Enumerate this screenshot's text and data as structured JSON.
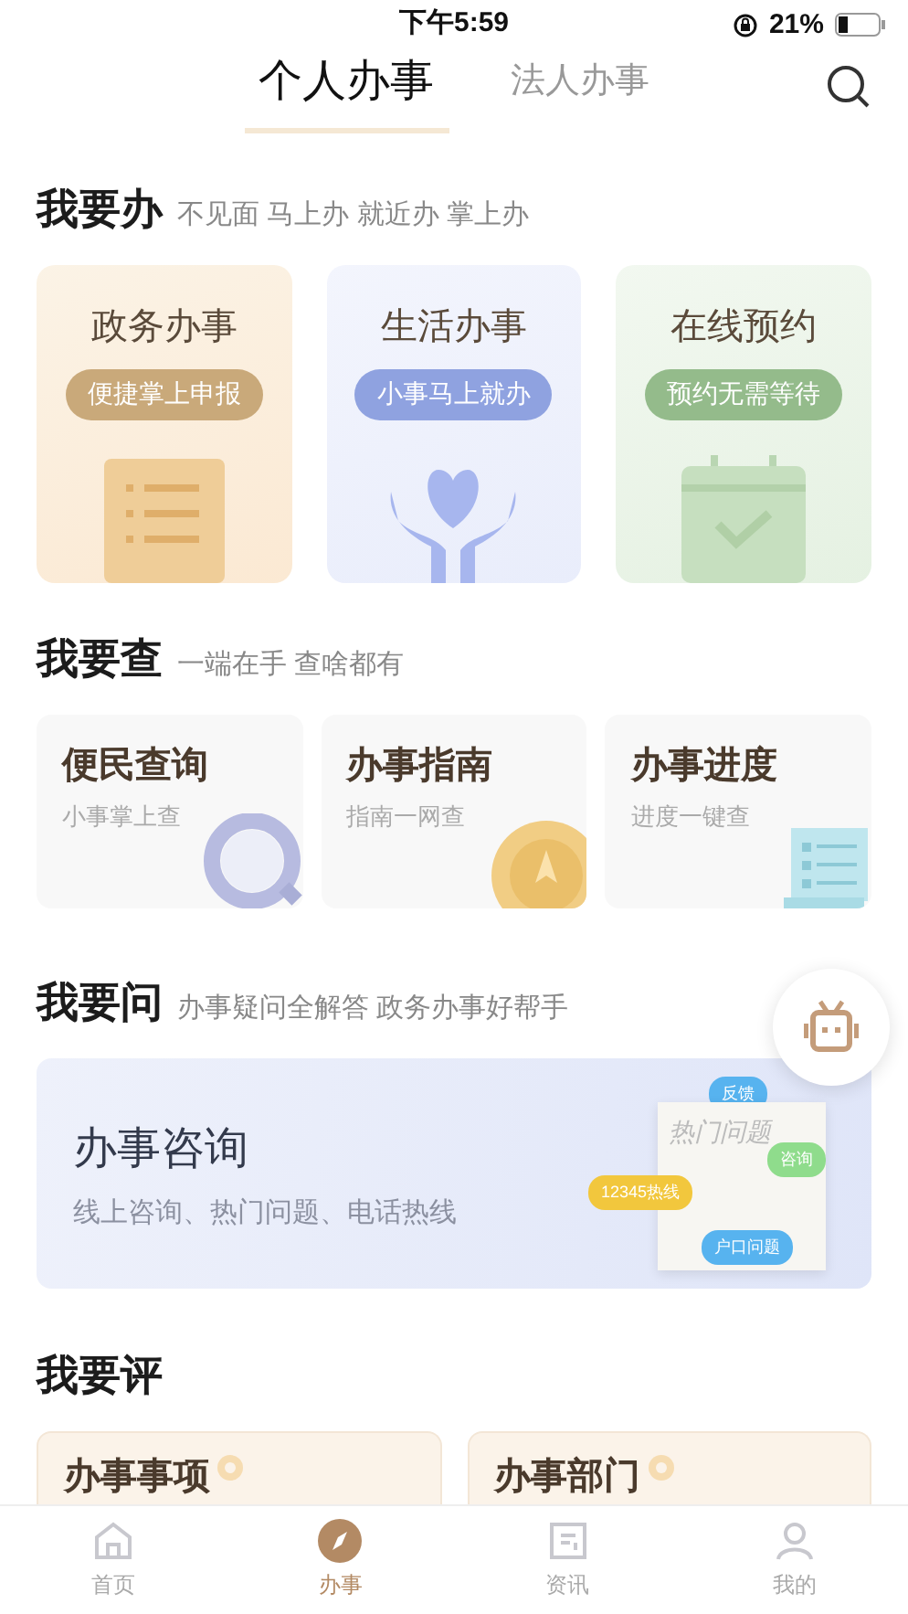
{
  "status_bar": {
    "time": "下午5:59",
    "battery": "21%"
  },
  "top_tabs": [
    {
      "label": "个人办事",
      "selected": true
    },
    {
      "label": "法人办事",
      "selected": false
    }
  ],
  "sections": [
    {
      "kind": "service",
      "title": "我要办",
      "subtitle": "不见面 马上办 就近办 掌上办",
      "cards": [
        {
          "kind": "document",
          "title": "政务办事",
          "tag": "便捷掌上申报"
        },
        {
          "kind": "hands",
          "title": "生活办事",
          "tag": "小事马上就办"
        },
        {
          "kind": "calendar",
          "title": "在线预约",
          "tag": "预约无需等待"
        }
      ]
    },
    {
      "kind": "query",
      "title": "我要查",
      "subtitle": "一端在手 查啥都有",
      "cards": [
        {
          "kind": "magnifier",
          "title": "便民查询",
          "tag": "小事掌上查"
        },
        {
          "kind": "compass",
          "title": "办事指南",
          "tag": "指南一网查"
        },
        {
          "kind": "scroll",
          "title": "办事进度",
          "tag": "进度一键查"
        }
      ]
    },
    {
      "kind": "ask",
      "title": "我要问",
      "subtitle": "办事疑问全解答 政务办事好帮手",
      "banner": {
        "title": "办事咨询",
        "subtitle": "线上咨询、热门问题、电话热线",
        "sheet_title": "热门问题",
        "bubbles": [
          {
            "kind": "top",
            "text": "反馈"
          },
          {
            "kind": "right",
            "text": "咨询"
          },
          {
            "kind": "left",
            "text": "12345热线"
          },
          {
            "kind": "bottom",
            "text": "户口问题"
          }
        ]
      }
    },
    {
      "kind": "rate",
      "title": "我要评",
      "cards": [
        {
          "title": "办事事项"
        },
        {
          "title": "办事部门"
        }
      ]
    }
  ],
  "bottom_tabs": [
    {
      "kind": "home",
      "label": "首页",
      "selected": false
    },
    {
      "kind": "compass",
      "label": "办事",
      "selected": true
    },
    {
      "kind": "news",
      "label": "资讯",
      "selected": false
    },
    {
      "kind": "person",
      "label": "我的",
      "selected": false
    }
  ]
}
